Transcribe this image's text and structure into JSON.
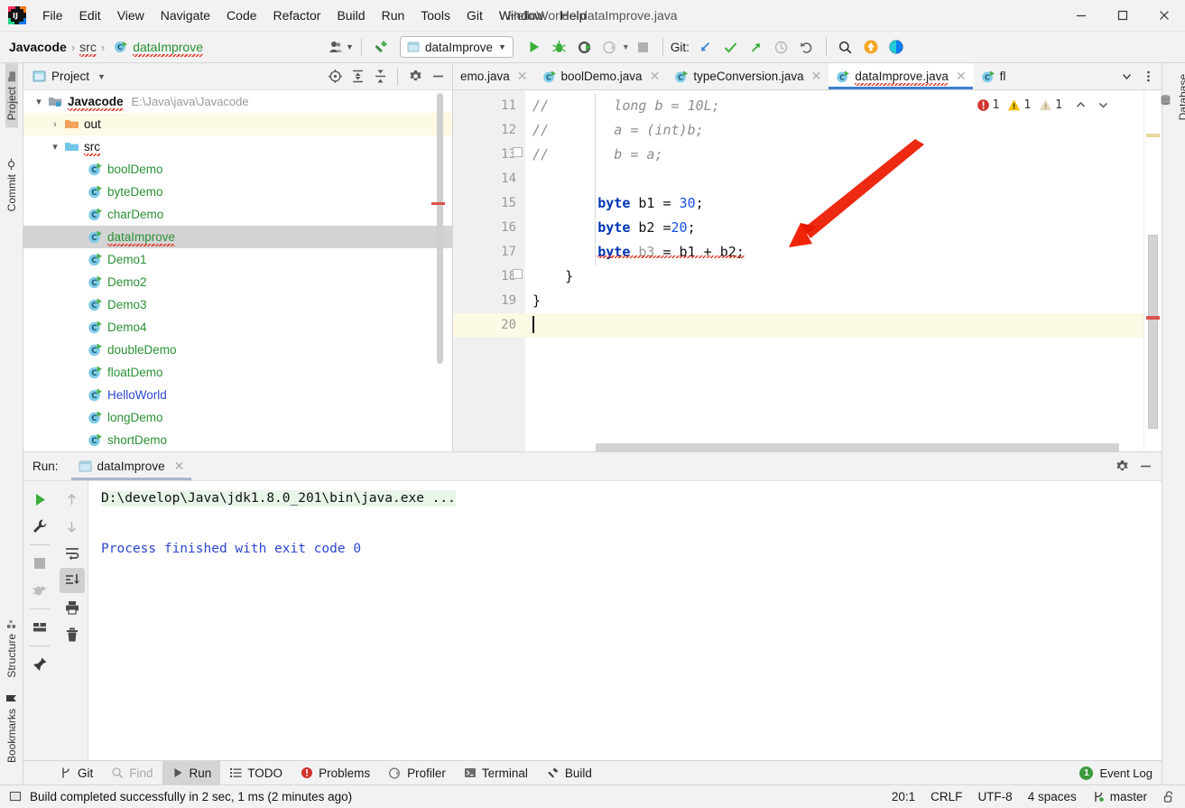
{
  "window": {
    "title": "HelloWorld - dataImprove.java",
    "minimize_label": "─",
    "maximize_label": "☐",
    "close_label": "✕",
    "logo_icon": "intellij-idea-logo"
  },
  "menubar": {
    "items": [
      {
        "label": "File",
        "mnemonic": "F"
      },
      {
        "label": "Edit",
        "mnemonic": "E"
      },
      {
        "label": "View",
        "mnemonic": "V"
      },
      {
        "label": "Navigate",
        "mnemonic": "N"
      },
      {
        "label": "Code",
        "mnemonic": "C"
      },
      {
        "label": "Refactor",
        "mnemonic": "R"
      },
      {
        "label": "Build",
        "mnemonic": "B"
      },
      {
        "label": "Run",
        "mnemonic": "u"
      },
      {
        "label": "Tools",
        "mnemonic": "T"
      },
      {
        "label": "Git",
        "mnemonic": "G"
      },
      {
        "label": "Window",
        "mnemonic": "W"
      },
      {
        "label": "Help",
        "mnemonic": "H"
      }
    ]
  },
  "navbar": {
    "breadcrumb": [
      "Javacode",
      "src",
      "dataImprove"
    ],
    "separator": "›",
    "run_config": "dataImprove",
    "git_label": "Git:",
    "icons": [
      "user-avatar-icon",
      "hammer-build-icon",
      "run-icon",
      "debug-icon",
      "run-with-coverage-icon",
      "profile-icon",
      "stop-icon",
      "git-update-icon",
      "git-commit-icon",
      "git-push-icon",
      "git-history-icon",
      "git-rollback-icon",
      "search-everywhere-icon",
      "update-project-icon",
      "ide-feature-icon"
    ]
  },
  "left_stripe": {
    "tabs": [
      {
        "label": "Project",
        "icon": "project-folder-icon",
        "selected": true
      },
      {
        "label": "Commit",
        "icon": "commit-icon",
        "selected": false
      },
      {
        "label": "Structure",
        "icon": "structure-icon",
        "selected": false
      },
      {
        "label": "Bookmarks",
        "icon": "bookmark-icon",
        "selected": false
      }
    ]
  },
  "right_stripe": {
    "tabs": [
      {
        "label": "Database",
        "icon": "database-icon"
      }
    ]
  },
  "project_pane": {
    "title": "Project",
    "header_icons": [
      "select-opened-file-icon",
      "expand-all-icon",
      "collapse-all-icon",
      "settings-gear-icon",
      "hide-icon"
    ],
    "tree": [
      {
        "label": "Javacode",
        "path": "E:\\Java\\java\\Javacode",
        "icon": "module-icon",
        "indent": 0,
        "twist": "⌄",
        "style": "bold",
        "state": "normal"
      },
      {
        "label": "out",
        "path": "",
        "icon": "folder-orange-icon",
        "indent": 1,
        "twist": "›",
        "style": "dark",
        "state": "highlight"
      },
      {
        "label": "src",
        "path": "",
        "icon": "folder-source-icon",
        "indent": 1,
        "twist": "⌄",
        "style": "dark",
        "state": "normal"
      },
      {
        "label": "boolDemo",
        "path": "",
        "icon": "java-class-runnable-icon",
        "indent": 2,
        "twist": "",
        "style": "green",
        "state": "normal"
      },
      {
        "label": "byteDemo",
        "path": "",
        "icon": "java-class-runnable-icon",
        "indent": 2,
        "twist": "",
        "style": "green",
        "state": "normal"
      },
      {
        "label": "charDemo",
        "path": "",
        "icon": "java-class-runnable-icon",
        "indent": 2,
        "twist": "",
        "style": "green",
        "state": "normal"
      },
      {
        "label": "dataImprove",
        "path": "",
        "icon": "java-class-runnable-icon",
        "indent": 2,
        "twist": "",
        "style": "green",
        "state": "selected"
      },
      {
        "label": "Demo1",
        "path": "",
        "icon": "java-class-runnable-icon",
        "indent": 2,
        "twist": "",
        "style": "green",
        "state": "normal"
      },
      {
        "label": "Demo2",
        "path": "",
        "icon": "java-class-runnable-icon",
        "indent": 2,
        "twist": "",
        "style": "green",
        "state": "normal"
      },
      {
        "label": "Demo3",
        "path": "",
        "icon": "java-class-runnable-icon",
        "indent": 2,
        "twist": "",
        "style": "green",
        "state": "normal"
      },
      {
        "label": "Demo4",
        "path": "",
        "icon": "java-class-runnable-icon",
        "indent": 2,
        "twist": "",
        "style": "green",
        "state": "normal"
      },
      {
        "label": "doubleDemo",
        "path": "",
        "icon": "java-class-runnable-icon",
        "indent": 2,
        "twist": "",
        "style": "green",
        "state": "normal"
      },
      {
        "label": "floatDemo",
        "path": "",
        "icon": "java-class-runnable-icon",
        "indent": 2,
        "twist": "",
        "style": "green",
        "state": "normal"
      },
      {
        "label": "HelloWorld",
        "path": "",
        "icon": "java-class-runnable-icon",
        "indent": 2,
        "twist": "",
        "style": "blue",
        "state": "normal"
      },
      {
        "label": "longDemo",
        "path": "",
        "icon": "java-class-runnable-icon",
        "indent": 2,
        "twist": "",
        "style": "green",
        "state": "normal"
      },
      {
        "label": "shortDemo",
        "path": "",
        "icon": "java-class-runnable-icon",
        "indent": 2,
        "twist": "",
        "style": "green",
        "state": "normal"
      }
    ]
  },
  "editor": {
    "tabs": [
      {
        "label": "emo.java",
        "active": false,
        "truncated": true
      },
      {
        "label": "boolDemo.java",
        "active": false,
        "truncated": false
      },
      {
        "label": "typeConversion.java",
        "active": false,
        "truncated": false
      },
      {
        "label": "dataImprove.java",
        "active": true,
        "truncated": false
      },
      {
        "label": "fl ",
        "active": false,
        "truncated": true
      }
    ],
    "tab_close_glyph": "✕",
    "tabs_overflow_icon": "chevron-down-icon",
    "tabs_menu_icon": "more-vertical-icon",
    "inspections": {
      "error_count": "1",
      "warning_count": "1",
      "weak_warning_count": "1",
      "prev_icon": "chevron-up-icon",
      "next_icon": "chevron-down-icon"
    },
    "lines": [
      {
        "num": "11",
        "comment": "//",
        "code": "      long b = 10L;",
        "kind": "comment",
        "fold": false
      },
      {
        "num": "12",
        "comment": "//",
        "code": "      a = (int)b;",
        "kind": "comment",
        "fold": false
      },
      {
        "num": "13",
        "comment": "//",
        "code": "      b = a;",
        "kind": "comment",
        "fold": true
      },
      {
        "num": "14",
        "comment": "",
        "code": "",
        "kind": "blank",
        "fold": false
      },
      {
        "num": "15",
        "comment": "",
        "code": "byte b1 = 30;",
        "kind": "decl",
        "fold": false
      },
      {
        "num": "16",
        "comment": "",
        "code": "byte b2 =20;",
        "kind": "decl",
        "fold": false
      },
      {
        "num": "17",
        "comment": "",
        "code": "byte b3 = b1 + b2;",
        "kind": "error",
        "fold": false
      },
      {
        "num": "18",
        "comment": "",
        "code": "}",
        "kind": "brace-inner",
        "fold": true
      },
      {
        "num": "19",
        "comment": "",
        "code": "}",
        "kind": "brace-outer",
        "fold": false
      },
      {
        "num": "20",
        "comment": "",
        "code": "",
        "kind": "caret",
        "fold": false
      }
    ],
    "code_tokens": {
      "l11": [
        "long",
        " b = ",
        "10L",
        ";"
      ],
      "l12": [
        "a = (int)b;"
      ],
      "l13": [
        "b = a;"
      ],
      "l15": [
        "byte",
        " b1 = ",
        "30",
        ";"
      ],
      "l16": [
        "byte",
        " b2 =",
        "20",
        ";"
      ],
      "l17": [
        "byte",
        " b3 = b1 + b2;"
      ]
    },
    "annotation": {
      "type": "red-arrow",
      "color": "#ee2200"
    }
  },
  "run_panel": {
    "label": "Run:",
    "tab_title": "dataImprove",
    "tab_icon": "run-config-icon",
    "tab_close": "✕",
    "header_icons": [
      "settings-gear-icon",
      "hide-icon"
    ],
    "toolbar_left": [
      "rerun-icon",
      "wrench-settings-icon",
      "stop-icon",
      "resume-icon",
      "layout-icon",
      "pin-icon"
    ],
    "toolbar_right": [
      "up-arrow-icon",
      "down-arrow-icon",
      "soft-wrap-icon",
      "scroll-to-end-icon",
      "print-icon",
      "trash-icon"
    ],
    "console": {
      "command": "D:\\develop\\Java\\jdk1.8.0_201\\bin\\java.exe ...",
      "output": "Process finished with exit code 0"
    }
  },
  "toolwindow_bar": {
    "items": [
      {
        "label": "Git",
        "icon": "git-branch-icon",
        "selected": false,
        "dim": false
      },
      {
        "label": "Find",
        "icon": "search-icon",
        "selected": false,
        "dim": true
      },
      {
        "label": "Run",
        "icon": "run-triangle-icon",
        "selected": true,
        "dim": false
      },
      {
        "label": "TODO",
        "icon": "todo-list-icon",
        "selected": false,
        "dim": false
      },
      {
        "label": "Problems",
        "icon": "problems-error-icon",
        "selected": false,
        "dim": false
      },
      {
        "label": "Profiler",
        "icon": "profiler-icon",
        "selected": false,
        "dim": false
      },
      {
        "label": "Terminal",
        "icon": "terminal-icon",
        "selected": false,
        "dim": false
      },
      {
        "label": "Build",
        "icon": "build-hammer-icon",
        "selected": false,
        "dim": false
      }
    ],
    "event_log": {
      "label": "Event Log",
      "badge": "1"
    }
  },
  "statusbar": {
    "message": "Build completed successfully in 2 sec, 1 ms (2 minutes ago)",
    "message_icon": "memory-indicator-icon",
    "caret_position": "20:1",
    "line_separator": "CRLF",
    "encoding": "UTF-8",
    "indent": "4 spaces",
    "branch": "master",
    "branch_icon": "git-branch-icon",
    "lock_icon": "unlocked-icon"
  },
  "colors": {
    "accent_blue": "#3c7fd0",
    "green": "#2a9134",
    "error_red": "#d9534f",
    "warning_yellow": "#e8c000",
    "panel_bg": "#f2f2f2",
    "editor_bg": "#ffffff",
    "selection_grey": "#d4d4d4",
    "current_line": "#fcf9e4",
    "arrow_red": "#ee2200"
  }
}
